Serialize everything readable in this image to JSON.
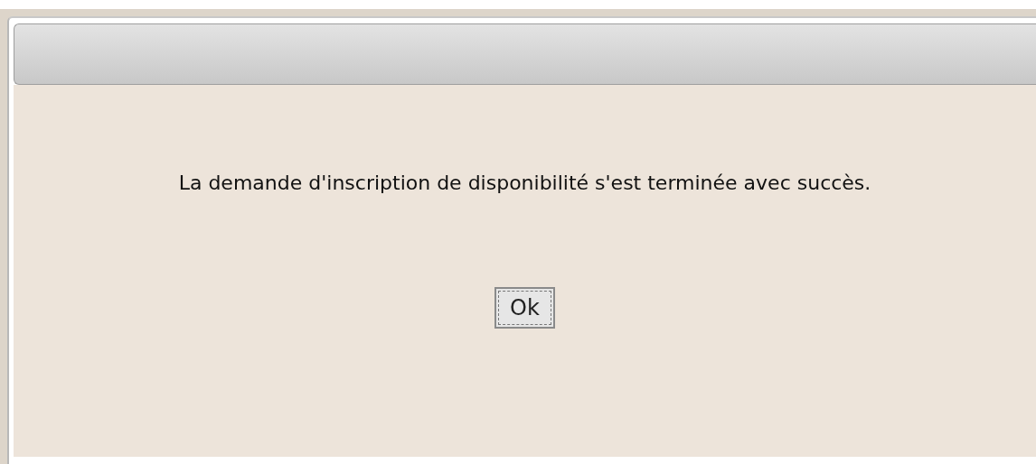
{
  "dialog": {
    "message": "La demande d'inscription de disponibilité s'est terminée avec succès.",
    "buttons": [
      {
        "label": "Ok",
        "focused": true
      }
    ]
  }
}
